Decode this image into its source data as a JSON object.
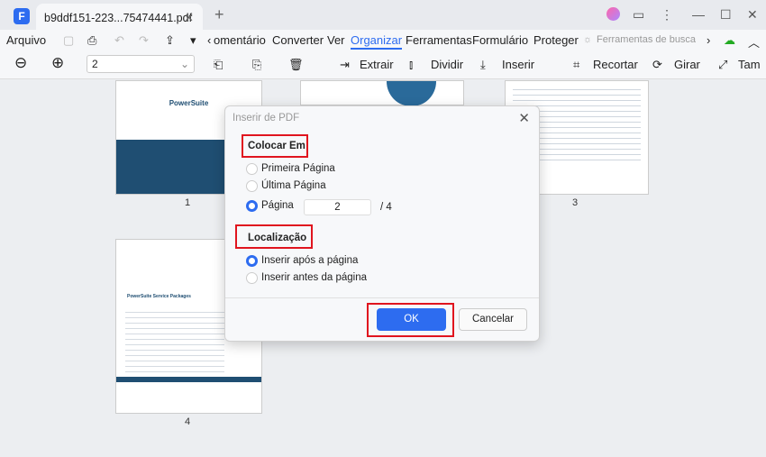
{
  "tab": {
    "title": "b9ddf151-223...75474441.pdf"
  },
  "menu": {
    "file": "Arquivo",
    "items": [
      "omentário",
      "Converter",
      "Ver",
      "Organizar",
      "Ferramentas",
      "Formulário",
      "Proteger"
    ],
    "search_tools": "Ferramentas de busca",
    "active": "Organizar"
  },
  "toolbar": {
    "page_value": "2",
    "extract": "Extrair",
    "split": "Dividir",
    "insert": "Inserir",
    "crop": "Recortar",
    "rotate": "Girar",
    "size": "Tam"
  },
  "pages": {
    "labels": [
      "1",
      "3",
      "4"
    ],
    "p1_title": "PowerSuite",
    "p4_title": "PowerSuite Service Packages"
  },
  "dialog": {
    "title": "Inserir de PDF",
    "section_place": "Colocar Em",
    "opt_first": "Primeira Página",
    "opt_last": "Última Página",
    "opt_page": "Página",
    "page_value": "2",
    "page_total": "/  4",
    "section_location": "Localização",
    "opt_after": "Inserir após a página",
    "opt_before": "Inserir antes da página",
    "ok": "OK",
    "cancel": "Cancelar",
    "selected_place": "Página",
    "selected_location": "Inserir após a página"
  },
  "colors": {
    "accent": "#2d6cf0",
    "highlight": "#e0141e"
  }
}
